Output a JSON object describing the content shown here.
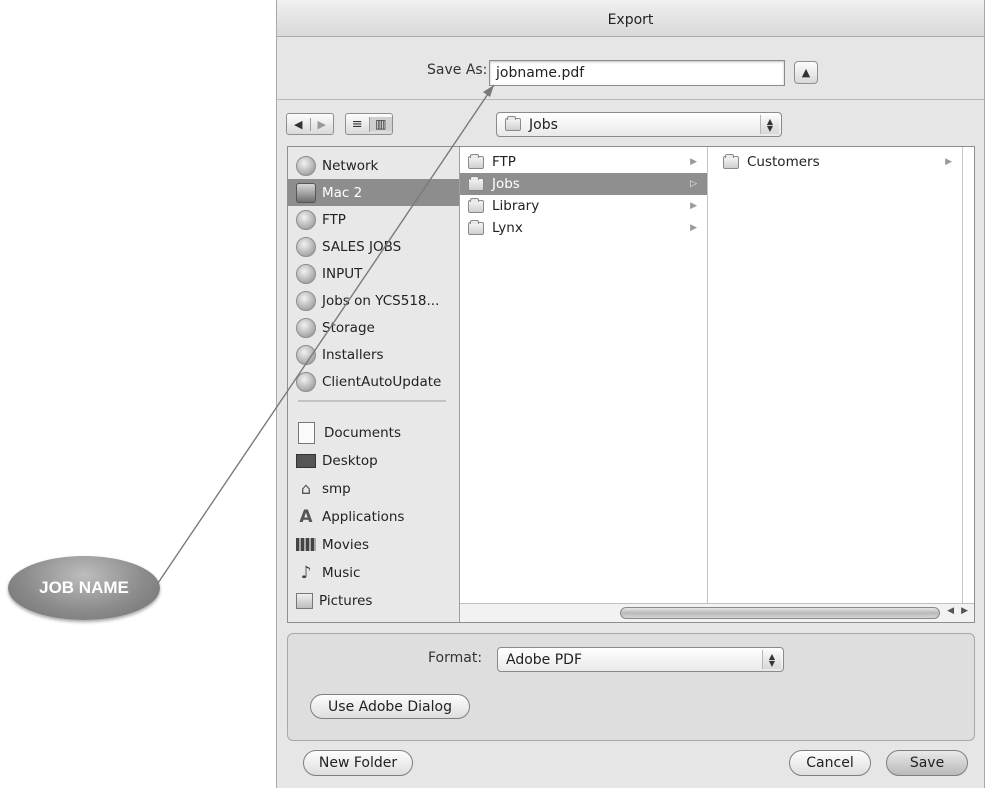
{
  "window": {
    "title": "Export"
  },
  "save_as": {
    "label": "Save As:",
    "value": "jobname.pdf"
  },
  "toolbar": {
    "location": "Jobs"
  },
  "sidebar": {
    "devices": [
      {
        "label": "Network",
        "icon": "network-globe-icon",
        "selected": false
      },
      {
        "label": "Mac 2",
        "icon": "mac-drive-icon",
        "selected": true
      },
      {
        "label": "FTP",
        "icon": "server-globe-icon",
        "selected": false
      },
      {
        "label": "SALES JOBS",
        "icon": "server-globe-icon",
        "selected": false
      },
      {
        "label": "INPUT",
        "icon": "server-globe-icon",
        "selected": false
      },
      {
        "label": "Jobs on YCS518...",
        "icon": "server-globe-icon",
        "selected": false
      },
      {
        "label": "Storage",
        "icon": "server-globe-icon",
        "selected": false
      },
      {
        "label": "Installers",
        "icon": "server-globe-icon",
        "selected": false
      },
      {
        "label": "ClientAutoUpdate",
        "icon": "server-globe-icon",
        "selected": false
      }
    ],
    "places": [
      {
        "label": "Documents",
        "icon": "documents-icon"
      },
      {
        "label": "Desktop",
        "icon": "desktop-icon"
      },
      {
        "label": "smp",
        "icon": "home-icon"
      },
      {
        "label": "Applications",
        "icon": "applications-icon"
      },
      {
        "label": "Movies",
        "icon": "movies-icon"
      },
      {
        "label": "Music",
        "icon": "music-icon"
      },
      {
        "label": "Pictures",
        "icon": "pictures-icon"
      }
    ]
  },
  "columns": [
    {
      "items": [
        {
          "label": "FTP",
          "selected": false
        },
        {
          "label": "Jobs",
          "selected": true
        },
        {
          "label": "Library",
          "selected": false
        },
        {
          "label": "Lynx",
          "selected": false
        }
      ]
    },
    {
      "items": [
        {
          "label": "Customers",
          "selected": false
        }
      ]
    }
  ],
  "format": {
    "label": "Format:",
    "value": "Adobe PDF"
  },
  "buttons": {
    "use_adobe_dialog": "Use Adobe Dialog",
    "new_folder": "New Folder",
    "cancel": "Cancel",
    "save": "Save"
  },
  "callout": {
    "text": "JOB NAME"
  }
}
